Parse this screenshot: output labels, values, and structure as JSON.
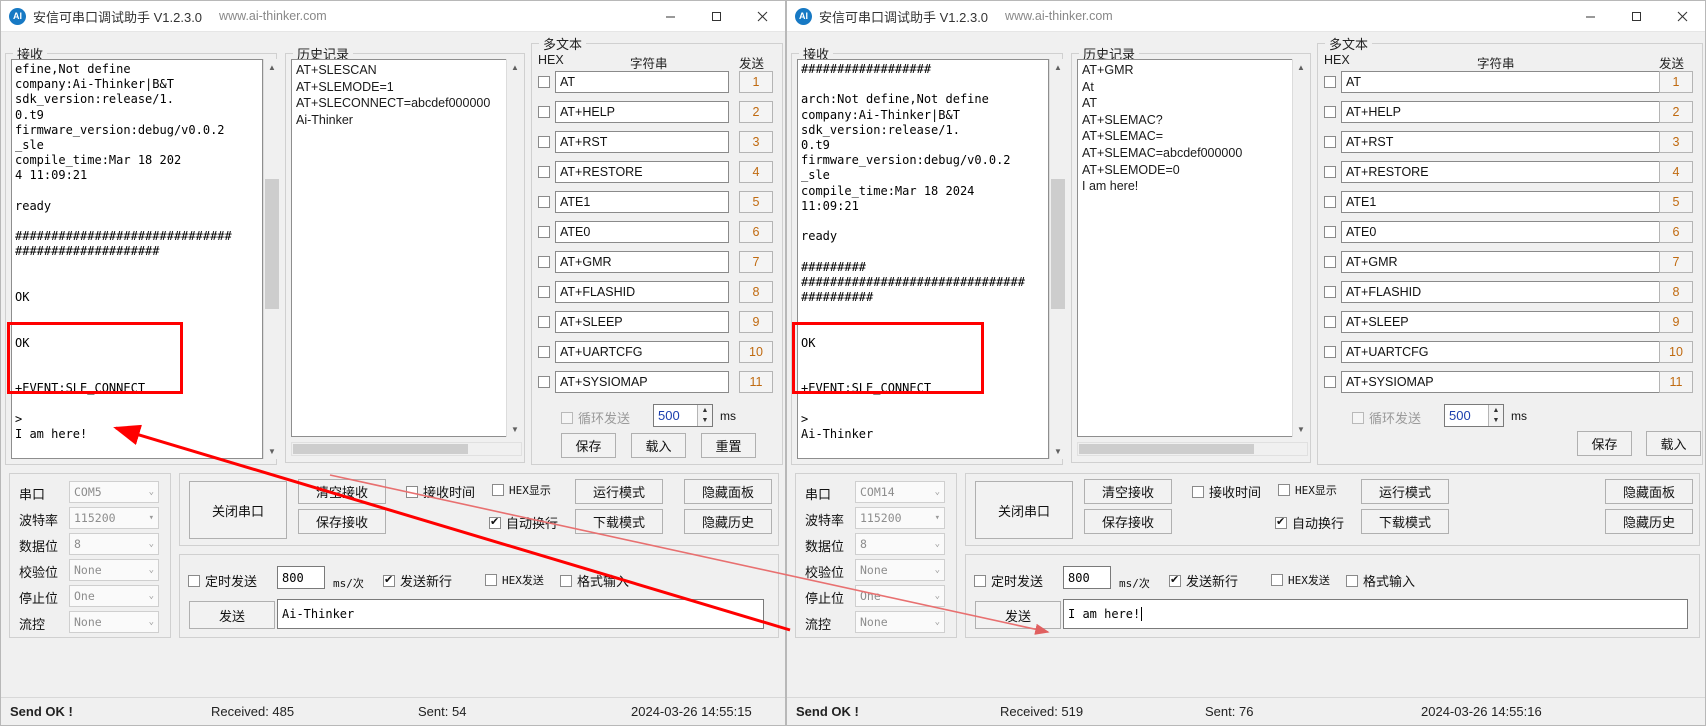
{
  "app": {
    "title": "安信可串口调试助手 V1.2.3.0",
    "url": "www.ai-thinker.com",
    "logo_text": "AI",
    "minimize": "–",
    "maximize": "□",
    "close": "✕"
  },
  "labels": {
    "receive_group": "接收",
    "history_group": "历史记录",
    "multitext_group": "多文本",
    "hex_col": "HEX",
    "string_col": "字符串",
    "send_col": "发送",
    "loop_send": "循环发送",
    "ms": "ms",
    "save": "保存",
    "load": "载入",
    "reset": "重置",
    "serial_port": "串口",
    "baud_rate": "波特率",
    "data_bits": "数据位",
    "parity": "校验位",
    "stop_bits": "停止位",
    "flow_ctrl": "流控",
    "close_port": "关闭串口",
    "clear_recv": "清空接收",
    "save_recv": "保存接收",
    "recv_time": "接收时间",
    "hex_display": "HEX显示",
    "run_mode": "运行模式",
    "hide_panel": "隐藏面板",
    "auto_wrap": "自动换行",
    "download_mode": "下载模式",
    "hide_history": "隐藏历史",
    "timed_send": "定时发送",
    "ms_per_time": "ms/次",
    "send_newline": "发送新行",
    "hex_send": "HEX发送",
    "format_input": "格式输入",
    "send_button": "发送"
  },
  "multitext_rows": [
    {
      "index": "1",
      "value": "AT",
      "hex_checked": false
    },
    {
      "index": "2",
      "value": "AT+HELP",
      "hex_checked": false
    },
    {
      "index": "3",
      "value": "AT+RST",
      "hex_checked": false
    },
    {
      "index": "4",
      "value": "AT+RESTORE",
      "hex_checked": false
    },
    {
      "index": "5",
      "value": "ATE1",
      "hex_checked": false
    },
    {
      "index": "6",
      "value": "ATE0",
      "hex_checked": false
    },
    {
      "index": "7",
      "value": "AT+GMR",
      "hex_checked": false
    },
    {
      "index": "8",
      "value": "AT+FLASHID",
      "hex_checked": false
    },
    {
      "index": "9",
      "value": "AT+SLEEP",
      "hex_checked": false
    },
    {
      "index": "10",
      "value": "AT+UARTCFG",
      "hex_checked": false
    },
    {
      "index": "11",
      "value": "AT+SYSIOMAP",
      "hex_checked": false
    }
  ],
  "left_window": {
    "receive_text": "efine,Not define\ncompany:Ai-Thinker|B&T\nsdk_version:release/1.\n0.t9\nfirmware_version:debug/v0.0.2\n_sle\ncompile_time:Mar 18 202\n4 11:09:21\n\nready\n\n##############################\n####################\n\n\nOK\n\n\nOK\n\n\n+EVENT:SLE_CONNECT\n\n>\nI am here!",
    "history_text": "AT+SLESCAN\nAT+SLEMODE=1\nAT+SLECONNECT=abcdef000000\nAi-Thinker",
    "loop_interval": "500",
    "serial_port": "COM5",
    "baud_rate": "115200",
    "data_bits": "8",
    "parity": "None",
    "stop_bits": "One",
    "flow_ctrl": "None",
    "timed_interval": "800",
    "send_text": "Ai-Thinker",
    "checks": {
      "loop_send": false,
      "recv_time": false,
      "hex_display": false,
      "auto_wrap": true,
      "timed_send": false,
      "send_newline": true,
      "hex_send": false,
      "format_input": false
    },
    "status": {
      "send_ok": "Send OK !",
      "received": "Received: 485",
      "sent": "Sent: 54",
      "datetime": "2024-03-26 14:55:15"
    }
  },
  "right_window": {
    "receive_text": "##################\n\narch:Not define,Not define\ncompany:Ai-Thinker|B&T\nsdk_version:release/1.\n0.t9\nfirmware_version:debug/v0.0.2\n_sle\ncompile_time:Mar 18 2024\n11:09:21\n\nready\n\n#########\n###############################\n##########\n\n\nOK\n\n\n+EVENT:SLE_CONNECT\n\n>\nAi-Thinker",
    "history_text": "AT+GMR\nAt\nAT\nAT+SLEMAC?\nAT+SLEMAC=\nAT+SLEMAC=abcdef000000\nAT+SLEMODE=0\nI am here!",
    "loop_interval": "500",
    "serial_port": "COM14",
    "baud_rate": "115200",
    "data_bits": "8",
    "parity": "None",
    "stop_bits": "One",
    "flow_ctrl": "None",
    "timed_interval": "800",
    "send_text": "I am here!",
    "checks": {
      "loop_send": false,
      "recv_time": false,
      "hex_display": false,
      "auto_wrap": true,
      "timed_send": false,
      "send_newline": true,
      "hex_send": false,
      "format_input": false
    },
    "status": {
      "send_ok": "Send OK !",
      "received": "Received: 519",
      "sent": "Sent: 76",
      "datetime": "2024-03-26 14:55:16"
    }
  },
  "annotations": {
    "highlight_color": "#ff0000",
    "left_box_label": "OK +EVENT:SLE_CONNECT",
    "right_box_label": "OK +EVENT:SLE_CONNECT"
  }
}
